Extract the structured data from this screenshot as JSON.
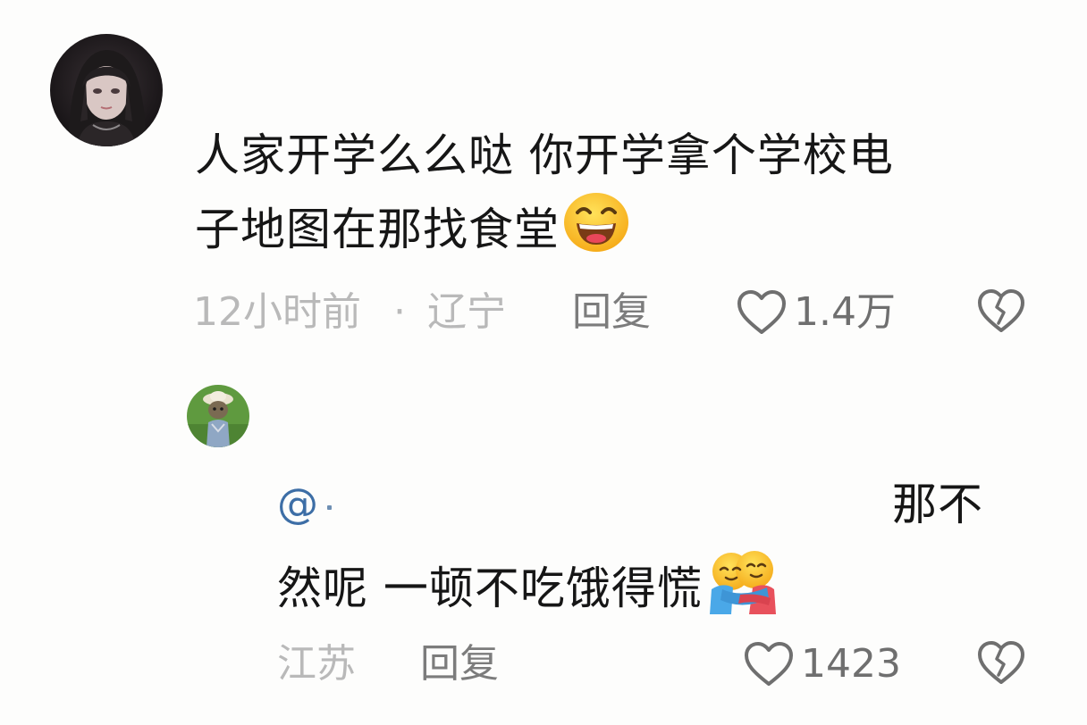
{
  "comment": {
    "avatar_icon": "user-avatar-girl",
    "text_line1": "人家开学么么哒 你开学拿个学校电",
    "text_line2": "子地图在那找食堂",
    "emoji": "grinning-face-emoji",
    "time": "12小时前",
    "separator": "·",
    "location": "辽宁",
    "reply_label": "回复",
    "like_icon": "heart-outline-icon",
    "like_count": "1.4万",
    "dislike_icon": "broken-heart-icon"
  },
  "reply": {
    "avatar_icon": "user-avatar-cat",
    "mention": "@",
    "text_line1_right": "那不",
    "text_line2": "然呢 一顿不吃饿得慌",
    "emoji": "hugging-face-emoji",
    "location": "江苏",
    "reply_label": "回复",
    "like_icon": "heart-outline-icon",
    "like_count": "1423",
    "dislike_icon": "broken-heart-icon"
  },
  "colors": {
    "background": "#fdfdfc",
    "text": "#161616",
    "muted": "#b9b9b9",
    "mention": "#3d6ea6"
  }
}
